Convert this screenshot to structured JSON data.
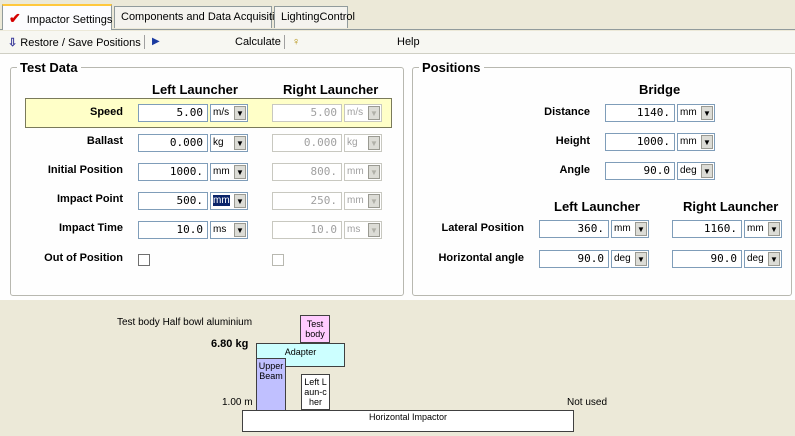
{
  "tabs": [
    {
      "label": "Impactor Settings",
      "active": true
    },
    {
      "label": "Components and Data Acquisition",
      "active": false
    },
    {
      "label": "LightingControl",
      "active": false
    }
  ],
  "toolbar": {
    "restore_save_label": "Restore / Save Positions",
    "calculate_label": "Calculate",
    "help_label": "Help"
  },
  "test_data": {
    "legend": "Test Data",
    "left_header": "Left Launcher",
    "right_header": "Right Launcher",
    "rows": [
      {
        "label": "Speed",
        "left_value": "5.00",
        "left_unit": "m/s",
        "right_value": "5.00",
        "right_unit": "m/s"
      },
      {
        "label": "Ballast",
        "left_value": "0.000",
        "left_unit": "kg",
        "right_value": "0.000",
        "right_unit": "kg"
      },
      {
        "label": "Initial Position",
        "left_value": "1000.",
        "left_unit": "mm",
        "right_value": "800.",
        "right_unit": "mm"
      },
      {
        "label": "Impact Point",
        "left_value": "500.",
        "left_unit": "mm",
        "right_value": "250.",
        "right_unit": "mm"
      },
      {
        "label": "Impact Time",
        "left_value": "10.0",
        "left_unit": "ms",
        "right_value": "10.0",
        "right_unit": "ms"
      }
    ],
    "out_of_position_label": "Out of Position",
    "out_of_position_left": false,
    "out_of_position_right": false
  },
  "positions": {
    "legend": "Positions",
    "bridge_header": "Bridge",
    "distance_label": "Distance",
    "distance_value": "1140.",
    "distance_unit": "mm",
    "height_label": "Height",
    "height_value": "1000.",
    "height_unit": "mm",
    "angle_label": "Angle",
    "angle_value": "90.0",
    "angle_unit": "deg",
    "left_header": "Left Launcher",
    "right_header": "Right Launcher",
    "lateral_label": "Lateral Position",
    "lateral_left_value": "360.",
    "lateral_left_unit": "mm",
    "lateral_right_value": "1160.",
    "lateral_right_unit": "mm",
    "horizontal_label": "Horizontal angle",
    "horizontal_left_value": "90.0",
    "horizontal_left_unit": "deg",
    "horizontal_right_value": "90.0",
    "horizontal_right_unit": "deg"
  },
  "diagram": {
    "test_body_caption": "Test body Half bowl aluminium",
    "mass": "6.80 kg",
    "test_body_box": "Test body",
    "adapter_box": "Adapter",
    "upper_beam_box": "Upper Beam",
    "left_launcher_box": "Left Laun-cher",
    "height_label": "1.00 m",
    "not_used_label": "Not used",
    "horizontal_impactor_box": "Horizontal Impactor"
  },
  "colors": {
    "speed_highlight": "#ffffc8",
    "test_body": "#ffccff",
    "adapter": "#ccffff",
    "upper_beam": "#c0c0ff",
    "tab_accent": "#ffc83c"
  }
}
